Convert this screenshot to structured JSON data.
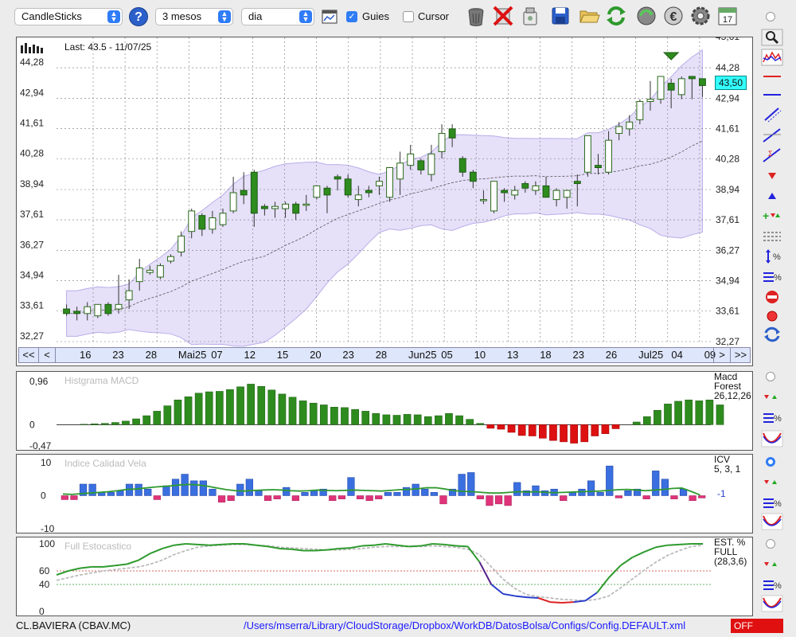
{
  "toolbar": {
    "chart_type": "CandleSticks",
    "period": "3 mesos",
    "interval": "dia",
    "guides_label": "Guies",
    "guides_checked": true,
    "cursor_label": "Cursor",
    "cursor_checked": false
  },
  "main_chart": {
    "last_label": "Last: 43.5 - 11/07/25",
    "y_ticks": [
      "44,28",
      "42,94",
      "41,61",
      "40,28",
      "38,94",
      "37,61",
      "36,27",
      "34,94",
      "33,61",
      "32,27"
    ],
    "top_partial_tick": "45,61",
    "price_badge": "43,50",
    "x_labels": [
      "16",
      "23",
      "28",
      "Mai25",
      "07",
      "12",
      "15",
      "20",
      "23",
      "28",
      "Jun25",
      "05",
      "10",
      "13",
      "18",
      "23",
      "26",
      "Jul25",
      "04",
      "09"
    ],
    "nav_first": "<<",
    "nav_prev": "<",
    "nav_next": ">",
    "nav_last": ">>"
  },
  "macd_panel": {
    "title": "Histgrama MACD",
    "name": "Macd",
    "name2": "Forest",
    "params": "26,12,26",
    "y_ticks": [
      "0,96",
      "0",
      "-0,47"
    ]
  },
  "icv_panel": {
    "title": "Indice Calidad Vela",
    "name": "ICV",
    "params": "5, 3, 1",
    "value": "-1",
    "y_ticks": [
      "10",
      "0",
      "-10"
    ]
  },
  "stoch_panel": {
    "title": "Full Estocastico",
    "name": "EST. %",
    "name2": "FULL",
    "params": "(28,3,6)",
    "y_ticks": [
      "100",
      "60",
      "40",
      "0"
    ]
  },
  "statusbar": {
    "ticker": "CL.BAVIERA (CBAV.MC)",
    "path": "/Users/mserra/Library/CloudStorage/Dropbox/WorkDB/DatosBolsa/Configs/Config.DEFAULT.xml",
    "status": "OFF"
  },
  "colors": {
    "up": "#2e8b1e",
    "down": "#2e8b1e",
    "band": "#ddd6f7",
    "macd_pos": "#2e8b1e",
    "macd_neg": "#dd1111",
    "icv_pos": "#3a6fe0",
    "icv_neg": "#e0337a",
    "accent": "#2f7cf6",
    "off": "#e01010"
  },
  "icons": [
    "chart-type-icon",
    "help-icon",
    "calendar-icon",
    "trash-icon",
    "delete-icon",
    "clean-icon",
    "save-icon",
    "open-folder-icon",
    "refresh-icon",
    "update-icon",
    "euro-icon",
    "settings-icon",
    "date-icon"
  ],
  "chart_data": {
    "type": "candlestick",
    "ylim": [
      32.27,
      45.61
    ],
    "candles": [
      {
        "o": 33.7,
        "h": 33.9,
        "l": 33.4,
        "c": 33.5
      },
      {
        "o": 33.6,
        "h": 33.8,
        "l": 33.2,
        "c": 33.5
      },
      {
        "o": 33.5,
        "h": 34.0,
        "l": 33.2,
        "c": 33.8
      },
      {
        "o": 33.4,
        "h": 33.9,
        "l": 33.3,
        "c": 33.9
      },
      {
        "o": 33.9,
        "h": 34.0,
        "l": 33.4,
        "c": 33.5
      },
      {
        "o": 33.7,
        "h": 35.2,
        "l": 33.5,
        "c": 33.9
      },
      {
        "o": 34.1,
        "h": 35.0,
        "l": 33.7,
        "c": 34.5
      },
      {
        "o": 34.9,
        "h": 35.9,
        "l": 34.5,
        "c": 35.5
      },
      {
        "o": 35.3,
        "h": 35.6,
        "l": 35.2,
        "c": 35.4
      },
      {
        "o": 35.1,
        "h": 35.7,
        "l": 35.0,
        "c": 35.6
      },
      {
        "o": 35.8,
        "h": 36.1,
        "l": 35.7,
        "c": 36.0
      },
      {
        "o": 36.2,
        "h": 37.1,
        "l": 36.0,
        "c": 36.9
      },
      {
        "o": 37.1,
        "h": 38.1,
        "l": 36.8,
        "c": 38.0
      },
      {
        "o": 37.8,
        "h": 37.9,
        "l": 36.9,
        "c": 37.2
      },
      {
        "o": 37.2,
        "h": 38.0,
        "l": 37.0,
        "c": 37.7
      },
      {
        "o": 37.4,
        "h": 38.1,
        "l": 37.3,
        "c": 37.9
      },
      {
        "o": 38.0,
        "h": 39.5,
        "l": 37.9,
        "c": 38.8
      },
      {
        "o": 38.9,
        "h": 39.7,
        "l": 38.3,
        "c": 38.7
      },
      {
        "o": 39.7,
        "h": 39.8,
        "l": 37.3,
        "c": 37.9
      },
      {
        "o": 38.2,
        "h": 38.3,
        "l": 37.8,
        "c": 38.1
      },
      {
        "o": 38.1,
        "h": 38.4,
        "l": 37.7,
        "c": 38.2
      },
      {
        "o": 38.1,
        "h": 38.4,
        "l": 37.7,
        "c": 38.3
      },
      {
        "o": 38.3,
        "h": 38.4,
        "l": 37.6,
        "c": 37.9
      },
      {
        "o": 38.3,
        "h": 38.7,
        "l": 38.0,
        "c": 38.3
      },
      {
        "o": 38.6,
        "h": 39.0,
        "l": 38.5,
        "c": 39.1
      },
      {
        "o": 39.0,
        "h": 39.1,
        "l": 37.9,
        "c": 38.7
      },
      {
        "o": 39.5,
        "h": 39.6,
        "l": 38.9,
        "c": 39.4
      },
      {
        "o": 39.4,
        "h": 39.6,
        "l": 38.6,
        "c": 38.7
      },
      {
        "o": 38.5,
        "h": 39.1,
        "l": 38.2,
        "c": 38.7
      },
      {
        "o": 38.9,
        "h": 39.1,
        "l": 38.6,
        "c": 38.8
      },
      {
        "o": 39.1,
        "h": 39.5,
        "l": 38.7,
        "c": 39.3
      },
      {
        "o": 38.6,
        "h": 39.8,
        "l": 38.4,
        "c": 39.9
      },
      {
        "o": 39.4,
        "h": 40.6,
        "l": 38.7,
        "c": 40.1
      },
      {
        "o": 40.0,
        "h": 40.9,
        "l": 39.8,
        "c": 40.5
      },
      {
        "o": 40.2,
        "h": 40.3,
        "l": 39.6,
        "c": 39.8
      },
      {
        "o": 39.6,
        "h": 40.9,
        "l": 39.3,
        "c": 40.5
      },
      {
        "o": 40.6,
        "h": 41.8,
        "l": 40.3,
        "c": 41.4
      },
      {
        "o": 41.6,
        "h": 41.8,
        "l": 40.8,
        "c": 41.2
      },
      {
        "o": 40.3,
        "h": 40.4,
        "l": 39.5,
        "c": 39.7
      },
      {
        "o": 39.7,
        "h": 39.8,
        "l": 39.0,
        "c": 39.3
      },
      {
        "o": 38.5,
        "h": 38.9,
        "l": 38.3,
        "c": 38.5
      },
      {
        "o": 38.0,
        "h": 39.3,
        "l": 37.9,
        "c": 39.3
      },
      {
        "o": 38.9,
        "h": 39.0,
        "l": 38.4,
        "c": 38.8
      },
      {
        "o": 38.7,
        "h": 39.1,
        "l": 38.5,
        "c": 38.9
      },
      {
        "o": 39.2,
        "h": 39.3,
        "l": 38.8,
        "c": 39.0
      },
      {
        "o": 38.9,
        "h": 39.3,
        "l": 38.7,
        "c": 39.1
      },
      {
        "o": 39.1,
        "h": 39.5,
        "l": 38.8,
        "c": 38.6
      },
      {
        "o": 38.5,
        "h": 39.0,
        "l": 38.2,
        "c": 38.9
      },
      {
        "o": 38.6,
        "h": 38.9,
        "l": 38.1,
        "c": 38.9
      },
      {
        "o": 39.3,
        "h": 39.6,
        "l": 38.2,
        "c": 39.2
      },
      {
        "o": 39.7,
        "h": 41.3,
        "l": 39.5,
        "c": 41.3
      },
      {
        "o": 40.0,
        "h": 40.5,
        "l": 39.6,
        "c": 39.9
      },
      {
        "o": 39.7,
        "h": 41.5,
        "l": 39.6,
        "c": 41.1
      },
      {
        "o": 41.4,
        "h": 41.9,
        "l": 41.1,
        "c": 41.7
      },
      {
        "o": 41.6,
        "h": 42.2,
        "l": 41.3,
        "c": 41.9
      },
      {
        "o": 42.0,
        "h": 42.9,
        "l": 41.8,
        "c": 42.8
      },
      {
        "o": 42.8,
        "h": 43.7,
        "l": 42.4,
        "c": 42.9
      },
      {
        "o": 42.9,
        "h": 43.9,
        "l": 42.7,
        "c": 43.9
      },
      {
        "o": 43.6,
        "h": 43.8,
        "l": 42.5,
        "c": 43.3
      },
      {
        "o": 43.1,
        "h": 43.9,
        "l": 42.9,
        "c": 43.8
      },
      {
        "o": 43.9,
        "h": 43.9,
        "l": 42.9,
        "c": 43.8
      },
      {
        "o": 43.8,
        "h": 43.8,
        "l": 43.0,
        "c": 43.5
      }
    ],
    "macd_histogram": [
      0.01,
      0.02,
      0.03,
      0.05,
      0.08,
      0.13,
      0.2,
      0.3,
      0.42,
      0.55,
      0.62,
      0.7,
      0.73,
      0.74,
      0.78,
      0.84,
      0.9,
      0.85,
      0.77,
      0.68,
      0.61,
      0.53,
      0.48,
      0.44,
      0.39,
      0.38,
      0.34,
      0.3,
      0.25,
      0.22,
      0.21,
      0.23,
      0.22,
      0.18,
      0.2,
      0.25,
      0.2,
      0.12,
      0.03,
      -0.08,
      -0.1,
      -0.17,
      -0.24,
      -0.25,
      -0.3,
      -0.35,
      -0.38,
      -0.41,
      -0.38,
      -0.25,
      -0.2,
      -0.09,
      0.0,
      0.06,
      0.18,
      0.32,
      0.46,
      0.52,
      0.55,
      0.53,
      0.55,
      0.44
    ],
    "icv_bars": [
      -1.2,
      -1.2,
      3.5,
      3.5,
      1.0,
      1.0,
      1.5,
      3.5,
      3.5,
      2,
      -1.2,
      3,
      5,
      6.5,
      4.5,
      4.5,
      2,
      -2,
      -1.5,
      3.5,
      5,
      1.5,
      -1.5,
      -1,
      2.5,
      -1.5,
      1.0,
      1.5,
      2,
      -1.5,
      -1,
      5.5,
      -1,
      -1.5,
      -1,
      1,
      1,
      2.5,
      3.5,
      2,
      1,
      -2.5,
      2,
      6.5,
      7,
      -1,
      -3,
      -2.5,
      -3,
      4,
      1.5,
      3,
      1.5,
      2,
      -1.5,
      1,
      2,
      4.5,
      1,
      9,
      -0.7,
      1.5,
      2,
      -1,
      7.5,
      5,
      -1,
      2,
      -1.5,
      -0.7
    ],
    "icv_line": [
      0.5,
      0.4,
      0.6,
      0.8,
      1.0,
      1.2,
      1.5,
      1.9,
      2.0,
      2.3,
      2.6,
      2.8,
      3.0,
      3.3,
      3.4,
      3.2,
      2.8,
      2.3,
      1.8,
      1.5,
      1.4,
      1.6,
      1.7,
      1.8,
      1.7,
      1.5,
      1.4,
      1.5,
      1.7,
      1.6,
      1.5,
      1.6,
      1.7,
      1.6,
      1.5,
      1.4,
      1.6,
      1.8,
      1.9,
      2.1,
      2.4,
      2.4,
      2.0,
      1.5,
      1.3,
      1.2,
      1.0,
      0.8,
      0.8,
      1.0,
      1.2,
      1.1,
      1.2,
      1.0,
      0.9,
      1.0,
      1.1,
      1.2,
      1.3,
      1.4,
      1.6,
      1.8,
      1.9,
      1.7,
      1.5,
      1.7,
      1.9,
      2.2,
      2.3,
      1.3,
      0.2
    ],
    "stoch_k": [
      54,
      60,
      64,
      66,
      66,
      68,
      70,
      76,
      86,
      93,
      98,
      100,
      99,
      98,
      99,
      100,
      100,
      98,
      96,
      93,
      92,
      90,
      90,
      91,
      93,
      94,
      97,
      98,
      100,
      98,
      96,
      97,
      100,
      99,
      97,
      96,
      73,
      40,
      26,
      23,
      21,
      20,
      14,
      13,
      14,
      16,
      28,
      50,
      68,
      80,
      88,
      95,
      98,
      99,
      100,
      100
    ],
    "stoch_d": [
      46,
      50,
      54,
      57,
      60,
      62,
      64,
      66,
      70,
      76,
      84,
      90,
      95,
      97,
      98,
      99,
      99,
      98,
      97,
      95,
      94,
      93,
      92,
      91,
      91,
      92,
      93,
      95,
      96,
      96,
      96,
      96,
      97,
      96,
      95,
      92,
      84,
      66,
      48,
      34,
      25,
      22,
      20,
      18,
      17,
      16,
      18,
      23,
      35,
      48,
      61,
      73,
      83,
      90,
      96,
      98
    ]
  }
}
